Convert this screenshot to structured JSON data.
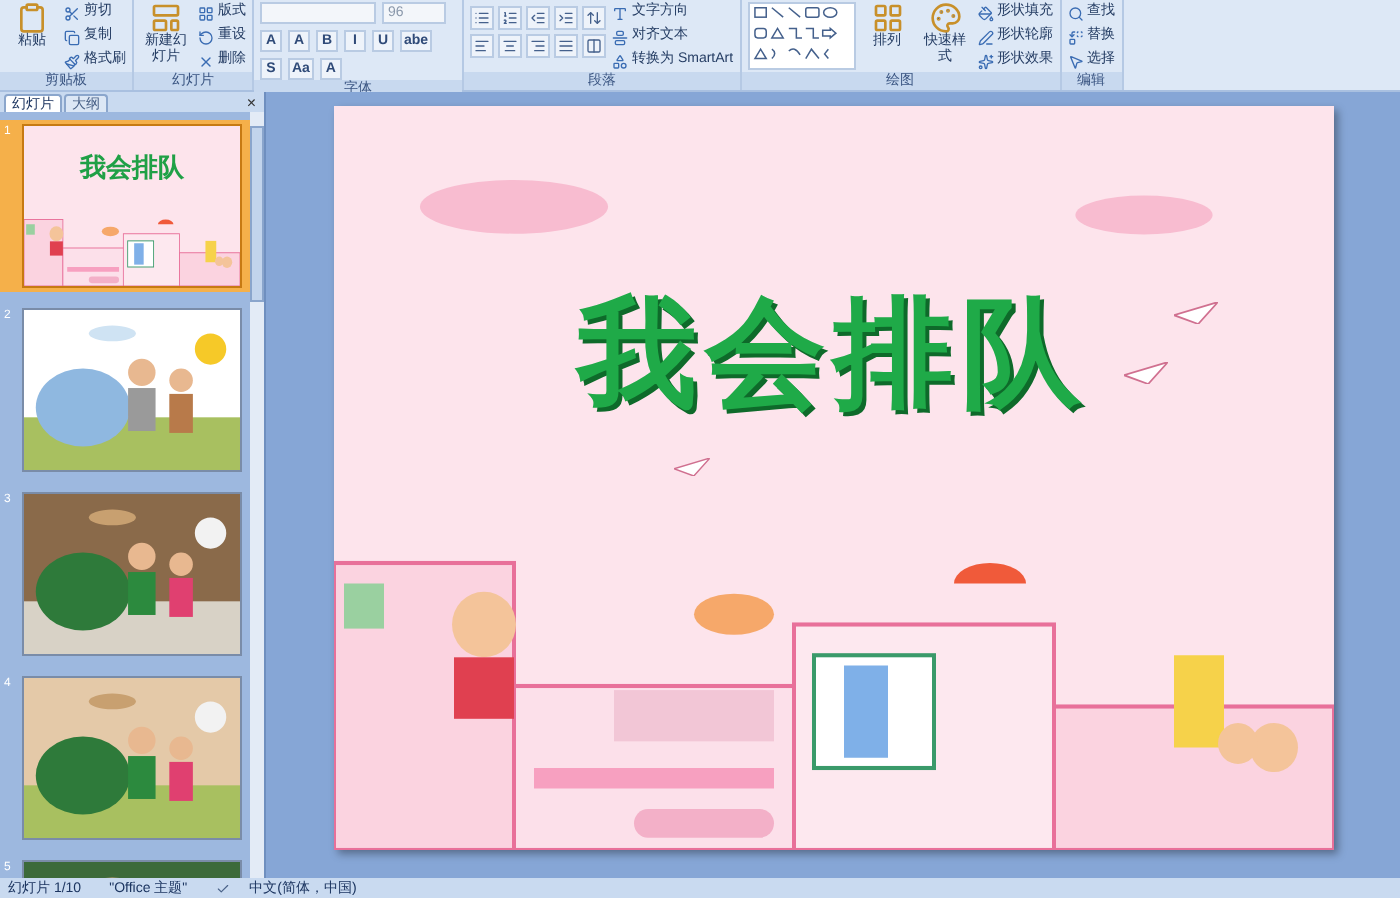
{
  "ribbon": {
    "groups": [
      {
        "label": "剪贴板",
        "items": [
          {
            "kind": "large",
            "label": "粘贴"
          },
          {
            "kind": "small",
            "label": "剪切"
          },
          {
            "kind": "small",
            "label": "复制"
          },
          {
            "kind": "small",
            "label": "格式刷"
          }
        ]
      },
      {
        "label": "幻灯片",
        "items": [
          {
            "kind": "large",
            "label": "新建幻灯片"
          },
          {
            "kind": "small",
            "label": "版式"
          },
          {
            "kind": "small",
            "label": "重设"
          },
          {
            "kind": "small",
            "label": "删除"
          }
        ]
      },
      {
        "label": "字体",
        "items": [
          {
            "kind": "field"
          },
          {
            "kind": "size",
            "label": "96"
          },
          {
            "kind": "glyph",
            "label": "A"
          },
          {
            "kind": "glyph",
            "label": "A"
          },
          {
            "kind": "glyph",
            "label": "B"
          },
          {
            "kind": "glyph",
            "label": "I"
          },
          {
            "kind": "glyph",
            "label": "U"
          },
          {
            "kind": "glyph",
            "label": "abe"
          },
          {
            "kind": "glyph",
            "label": "S"
          },
          {
            "kind": "glyph",
            "label": "Aa"
          },
          {
            "kind": "glyph",
            "label": "A"
          }
        ]
      },
      {
        "label": "段落",
        "items": [
          {
            "kind": "tools"
          },
          {
            "kind": "small",
            "label": "文字方向"
          },
          {
            "kind": "small",
            "label": "对齐文本"
          },
          {
            "kind": "small",
            "label": "转换为 SmartArt"
          }
        ]
      },
      {
        "label": "绘图",
        "items": [
          {
            "kind": "gallery"
          },
          {
            "kind": "large",
            "label": "排列"
          },
          {
            "kind": "large",
            "label": "快速样式"
          },
          {
            "kind": "small",
            "label": "形状填充"
          },
          {
            "kind": "small",
            "label": "形状轮廓"
          },
          {
            "kind": "small",
            "label": "形状效果"
          }
        ]
      },
      {
        "label": "编辑",
        "items": [
          {
            "kind": "small",
            "label": "查找"
          },
          {
            "kind": "small",
            "label": "替换"
          },
          {
            "kind": "small",
            "label": "选择"
          }
        ]
      }
    ]
  },
  "panel": {
    "tabs": [
      {
        "label": "幻灯片",
        "selected": true
      },
      {
        "label": "大纲",
        "selected": false
      }
    ],
    "close": "×",
    "slides": [
      {
        "number": "1",
        "kind": "title",
        "title": "我会排队",
        "selected": true
      },
      {
        "number": "2",
        "kind": "picture",
        "selected": false
      },
      {
        "number": "3",
        "kind": "picture",
        "selected": false
      },
      {
        "number": "4",
        "kind": "picture",
        "selected": false
      },
      {
        "number": "5",
        "kind": "picture",
        "selected": false
      }
    ]
  },
  "slide": {
    "title": "我会排队"
  },
  "status_bar": {
    "items": [
      "幻灯片 1/10",
      "\"Office 主题\"",
      "中文(简体，中国)"
    ]
  }
}
